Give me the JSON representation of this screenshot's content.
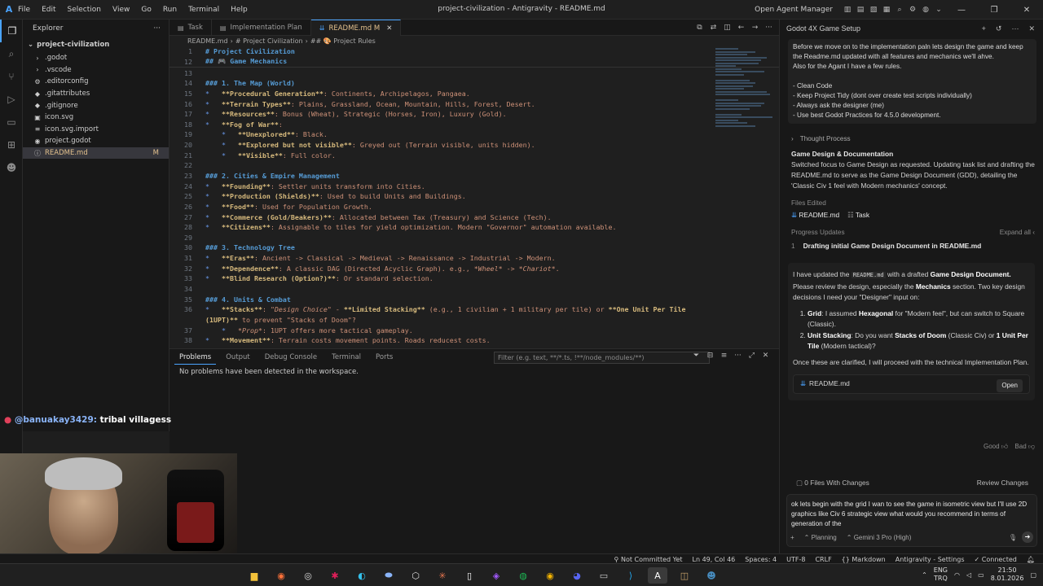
{
  "titlebar": {
    "menu": [
      "File",
      "Edit",
      "Selection",
      "View",
      "Go",
      "Run",
      "Terminal",
      "Help"
    ],
    "title": "project-civilization - Antigravity - README.md",
    "open_agent_manager": "Open Agent Manager"
  },
  "explorer": {
    "title": "Explorer",
    "project": "project-civilization",
    "items": [
      {
        "name": ".godot",
        "icon": "›"
      },
      {
        "name": ".vscode",
        "icon": "›"
      },
      {
        "name": ".editorconfig",
        "icon": "⚙"
      },
      {
        "name": ".gitattributes",
        "icon": "◆"
      },
      {
        "name": ".gitignore",
        "icon": "◆"
      },
      {
        "name": "icon.svg",
        "icon": "▣"
      },
      {
        "name": "icon.svg.import",
        "icon": "≡"
      },
      {
        "name": "project.godot",
        "icon": "◉"
      },
      {
        "name": "README.md",
        "icon": "ⓘ",
        "badge": "M"
      }
    ]
  },
  "tabs": [
    {
      "label": "Task",
      "active": false
    },
    {
      "label": "Implementation Plan",
      "active": false
    },
    {
      "label": "README.md M",
      "active": true
    }
  ],
  "breadcrumb": [
    "README.md",
    "# Project Civilization",
    "## 🎨 Project Rules"
  ],
  "editor": {
    "sticky": [
      {
        "n": "1",
        "text": "# Project Civilization"
      },
      {
        "n": "12",
        "text": "## 🎮 Game Mechanics"
      }
    ],
    "lines": [
      {
        "n": "13",
        "segs": []
      },
      {
        "n": "14",
        "segs": [
          {
            "c": "h",
            "t": "### 1. The Map (World)"
          }
        ]
      },
      {
        "n": "15",
        "segs": [
          {
            "c": "bul",
            "t": "*   "
          },
          {
            "c": "bl",
            "t": "**Procedural Generation**"
          },
          {
            "c": "t",
            "t": ": Continents, Archipelagos, Pangaea."
          }
        ]
      },
      {
        "n": "16",
        "segs": [
          {
            "c": "bul",
            "t": "*   "
          },
          {
            "c": "bl",
            "t": "**Terrain Types**"
          },
          {
            "c": "t",
            "t": ": Plains, Grassland, Ocean, Mountain, Hills, Forest, Desert."
          }
        ]
      },
      {
        "n": "17",
        "segs": [
          {
            "c": "bul",
            "t": "*   "
          },
          {
            "c": "bl",
            "t": "**Resources**"
          },
          {
            "c": "t",
            "t": ": Bonus (Wheat), Strategic (Horses, Iron), Luxury (Gold)."
          }
        ]
      },
      {
        "n": "18",
        "segs": [
          {
            "c": "bul",
            "t": "*   "
          },
          {
            "c": "bl",
            "t": "**Fog of War**"
          },
          {
            "c": "t",
            "t": ":"
          }
        ]
      },
      {
        "n": "19",
        "segs": [
          {
            "c": "bul",
            "t": "    *   "
          },
          {
            "c": "bl",
            "t": "**Unexplored**"
          },
          {
            "c": "t",
            "t": ": Black."
          }
        ]
      },
      {
        "n": "20",
        "segs": [
          {
            "c": "bul",
            "t": "    *   "
          },
          {
            "c": "bl",
            "t": "**Explored but not visible**"
          },
          {
            "c": "t",
            "t": ": Greyed out (Terrain visible, units hidden)."
          }
        ]
      },
      {
        "n": "21",
        "segs": [
          {
            "c": "bul",
            "t": "    *   "
          },
          {
            "c": "bl",
            "t": "**Visible**"
          },
          {
            "c": "t",
            "t": ": Full color."
          }
        ]
      },
      {
        "n": "22",
        "segs": []
      },
      {
        "n": "23",
        "segs": [
          {
            "c": "h",
            "t": "### 2. Cities & Empire Management"
          }
        ]
      },
      {
        "n": "24",
        "segs": [
          {
            "c": "bul",
            "t": "*   "
          },
          {
            "c": "bl",
            "t": "**Founding**"
          },
          {
            "c": "t",
            "t": ": Settler units transform into Cities."
          }
        ]
      },
      {
        "n": "25",
        "segs": [
          {
            "c": "bul",
            "t": "*   "
          },
          {
            "c": "bl",
            "t": "**Production (Shields)**"
          },
          {
            "c": "t",
            "t": ": Used to build Units and Buildings."
          }
        ]
      },
      {
        "n": "26",
        "segs": [
          {
            "c": "bul",
            "t": "*   "
          },
          {
            "c": "bl",
            "t": "**Food**"
          },
          {
            "c": "t",
            "t": ": Used for Population Growth."
          }
        ]
      },
      {
        "n": "27",
        "segs": [
          {
            "c": "bul",
            "t": "*   "
          },
          {
            "c": "bl",
            "t": "**Commerce (Gold/Beakers)**"
          },
          {
            "c": "t",
            "t": ": Allocated between Tax (Treasury) and Science (Tech)."
          }
        ]
      },
      {
        "n": "28",
        "segs": [
          {
            "c": "bul",
            "t": "*   "
          },
          {
            "c": "bl",
            "t": "**Citizens**"
          },
          {
            "c": "t",
            "t": ": Assignable to tiles for yield optimization. Modern \"Governor\" automation available."
          }
        ]
      },
      {
        "n": "29",
        "segs": []
      },
      {
        "n": "30",
        "segs": [
          {
            "c": "h",
            "t": "### 3. Technology Tree"
          }
        ]
      },
      {
        "n": "31",
        "segs": [
          {
            "c": "bul",
            "t": "*   "
          },
          {
            "c": "bl",
            "t": "**Eras**"
          },
          {
            "c": "t",
            "t": ": Ancient -> Classical -> Medieval -> Renaissance -> Industrial -> Modern."
          }
        ]
      },
      {
        "n": "32",
        "segs": [
          {
            "c": "bul",
            "t": "*   "
          },
          {
            "c": "bl",
            "t": "**Dependence**"
          },
          {
            "c": "t",
            "t": ": A classic DAG (Directed Acyclic Graph). e.g., "
          },
          {
            "c": "it",
            "t": "*Wheel*"
          },
          {
            "c": "t",
            "t": " -> "
          },
          {
            "c": "it",
            "t": "*Chariot*"
          },
          {
            "c": "t",
            "t": "."
          }
        ]
      },
      {
        "n": "33",
        "segs": [
          {
            "c": "bul",
            "t": "*   "
          },
          {
            "c": "bl",
            "t": "**Blind Research (Option?)**"
          },
          {
            "c": "t",
            "t": ": Or standard selection."
          }
        ]
      },
      {
        "n": "34",
        "segs": []
      },
      {
        "n": "35",
        "segs": [
          {
            "c": "h",
            "t": "### 4. Units & Combat"
          }
        ]
      },
      {
        "n": "36",
        "segs": [
          {
            "c": "bul",
            "t": "*   "
          },
          {
            "c": "bl",
            "t": "**Stacks**"
          },
          {
            "c": "t",
            "t": ": "
          },
          {
            "c": "it",
            "t": "\"Design Choice\""
          },
          {
            "c": "t",
            "t": " - "
          },
          {
            "c": "bl",
            "t": "**Limited Stacking**"
          },
          {
            "c": "t",
            "t": " (e.g., 1 civilian + 1 military per tile) or "
          },
          {
            "c": "bl",
            "t": "**One Unit Per Tile"
          }
        ]
      },
      {
        "n": "",
        "segs": [
          {
            "c": "bl",
            "t": "(1UPT)**"
          },
          {
            "c": "t",
            "t": " to prevent \"Stacks of Doom\"?"
          }
        ]
      },
      {
        "n": "37",
        "segs": [
          {
            "c": "bul",
            "t": "    *   "
          },
          {
            "c": "it",
            "t": "*Prop*"
          },
          {
            "c": "t",
            "t": ": 1UPT offers more tactical gameplay."
          }
        ]
      },
      {
        "n": "38",
        "segs": [
          {
            "c": "bul",
            "t": "*   "
          },
          {
            "c": "bl",
            "t": "**Movement**"
          },
          {
            "c": "t",
            "t": ": Terrain costs movement points. Roads reducest costs."
          }
        ]
      }
    ]
  },
  "panel": {
    "tabs": [
      "Problems",
      "Output",
      "Debug Console",
      "Terminal",
      "Ports"
    ],
    "filter_placeholder": "Filter (e.g. text, **/*.ts, !**/node_modules/**)",
    "message": "No problems have been detected in the workspace."
  },
  "stream": {
    "user": "@banuakay3429:",
    "message": "tribal villagess"
  },
  "agent": {
    "title": "Godot 4X Game Setup",
    "user_message": [
      "Before we move on to the implementation paln lets design the game and keep the Readme.md updated with all features and mechanics we'll ahve.",
      "Also for the Agant I have a few rules.",
      "",
      "- Clean Code",
      "- Keep Project Tidy (dont over create test scripts individually)",
      "- Always ask the designer (me)",
      "- Use best Godot Practices for 4.5.0 development."
    ],
    "thought_process": "Thought Process",
    "section_title": "Game Design & Documentation",
    "section_text": "Switched focus to Game Design as requested. Updating task list and drafting the README.md to serve as the Game Design Document (GDD), detailing the 'Classic Civ 1 feel with Modern mechanics' concept.",
    "files_edited_label": "Files Edited",
    "files_edited": [
      "README.md",
      "Task"
    ],
    "progress_label": "Progress Updates",
    "expand_all": "Expand all",
    "progress_item_num": "1",
    "progress_item": "Drafting initial Game Design Document in README.md",
    "response": {
      "p1_a": "I have updated the ",
      "p1_code": "README.md",
      "p1_b": " with a drafted ",
      "p1_bold": "Game Design Document.",
      "p1_c": " Please review the design, especially the ",
      "p1_mech": "Mechanics",
      "p1_d": " section. Two key design decisions I need your \"Designer\" input on:",
      "li1_label": "Grid",
      "li1_a": ": I assumed ",
      "li1_b": "Hexagonal",
      "li1_c": " for \"Modern feel\", but can switch to Square (Classic).",
      "li2_label": "Unit Stacking",
      "li2_a": ": Do you want ",
      "li2_b": "Stacks of Doom",
      "li2_c": " (Classic Civ) or ",
      "li2_d": "1 Unit Per Tile",
      "li2_e": " (Modern tactical)?",
      "p2": "Once these are clarified, I will proceed with the technical Implementation Plan.",
      "file_ref": "README.md",
      "open": "Open"
    },
    "good": "Good",
    "bad": "Bad",
    "files_with_changes": "0 Files With Changes",
    "review_changes": "Review Changes",
    "input_text": "ok lets begin with the grid I wan to see the game in isometric view but I'll use 2D graphics like Civ 6 strategic view what would you recommend in terms of generation of the",
    "mode": "Planning",
    "model": "Gemini 3 Pro (High)"
  },
  "statusbar": {
    "not_committed": "Not Committed Yet",
    "position": "Ln 49, Col 46",
    "spaces": "Spaces: 4",
    "encoding": "UTF-8",
    "eol": "CRLF",
    "language": "Markdown",
    "settings": "Antigravity - Settings",
    "connected": "Connected"
  },
  "taskbar": {
    "lang": "ENG",
    "region": "TRQ",
    "time": "21:50",
    "date": "8.01.2026"
  },
  "colors": {
    "accent": "#4aa3ff",
    "modified": "#e2c08d"
  }
}
